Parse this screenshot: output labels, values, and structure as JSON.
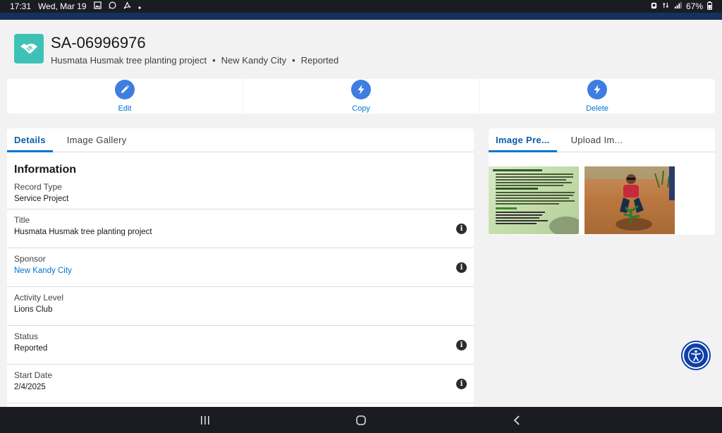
{
  "statusbar": {
    "time": "17:31",
    "date": "Wed, Mar 19",
    "battery": "67%"
  },
  "record": {
    "icon": "handshake-icon",
    "name": "SA-06996976",
    "subtitle_project": "Husmata Husmak tree planting project",
    "subtitle_sponsor": "New Kandy City",
    "subtitle_status": "Reported",
    "separator": "•"
  },
  "actions": [
    {
      "label": "Edit",
      "icon": "pencil-icon"
    },
    {
      "label": "Copy",
      "icon": "lightning-icon"
    },
    {
      "label": "Delete",
      "icon": "lightning-icon"
    }
  ],
  "left_tabs": [
    {
      "label": "Details",
      "active": true
    },
    {
      "label": "Image Gallery",
      "active": false
    }
  ],
  "section_title": "Information",
  "fields": [
    {
      "label": "Record Type",
      "value": "Service Project"
    },
    {
      "label": "Title",
      "value": "Husmata Husmak tree planting project"
    },
    {
      "label": "Sponsor",
      "value": "New Kandy City"
    },
    {
      "label": "Activity Level",
      "value": "Lions Club"
    },
    {
      "label": "Status",
      "value": "Reported"
    },
    {
      "label": "Start Date",
      "value": "2/4/2025"
    }
  ],
  "right_tabs": [
    {
      "label": "Image Pre...",
      "active": true
    },
    {
      "label": "Upload Im...",
      "active": false
    }
  ],
  "colors": {
    "accent": "#0176d3",
    "action_circle": "#3f7ee0",
    "record_icon": "#3ec2b5",
    "header_band": "#16325c"
  }
}
